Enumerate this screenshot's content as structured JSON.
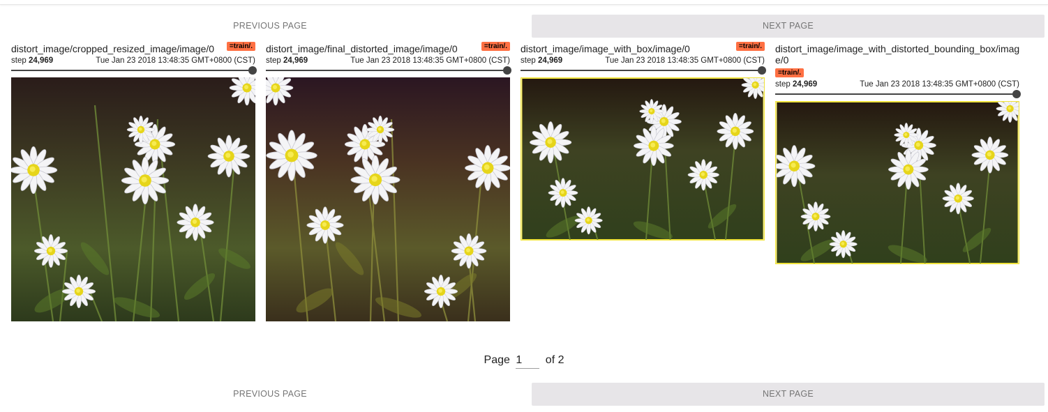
{
  "nav": {
    "prev_label": "PREVIOUS PAGE",
    "next_label": "NEXT PAGE"
  },
  "cards": [
    {
      "title": "distort_image/cropped_resized_image/image/0",
      "run": "=train/.",
      "step_label": "step",
      "step": "24,969",
      "time": "Tue Jan 23 2018 13:48:35 GMT+0800 (CST)",
      "slider_position": 1.0
    },
    {
      "title": "distort_image/final_distorted_image/image/0",
      "run": "=train/.",
      "step_label": "step",
      "step": "24,969",
      "time": "Tue Jan 23 2018 13:48:35 GMT+0800 (CST)",
      "slider_position": 1.0
    },
    {
      "title": "distort_image/image_with_box/image/0",
      "run": "=train/.",
      "step_label": "step",
      "step": "24,969",
      "time": "Tue Jan 23 2018 13:48:35 GMT+0800 (CST)",
      "slider_position": 1.0
    },
    {
      "title": "distort_image/image_with_distorted_bounding_box/image/0",
      "run": "=train/.",
      "step_label": "step",
      "step": "24,969",
      "time": "Tue Jan 23 2018 13:48:35 GMT+0800 (CST)",
      "slider_position": 1.0
    }
  ],
  "pager": {
    "prefix": "Page",
    "current": "1",
    "suffix": "of 2"
  },
  "colors": {
    "badge": "#ff7043",
    "next_button_bg": "#e7e5e8",
    "box_outline": "#f0e33a",
    "slider": "#444444"
  }
}
